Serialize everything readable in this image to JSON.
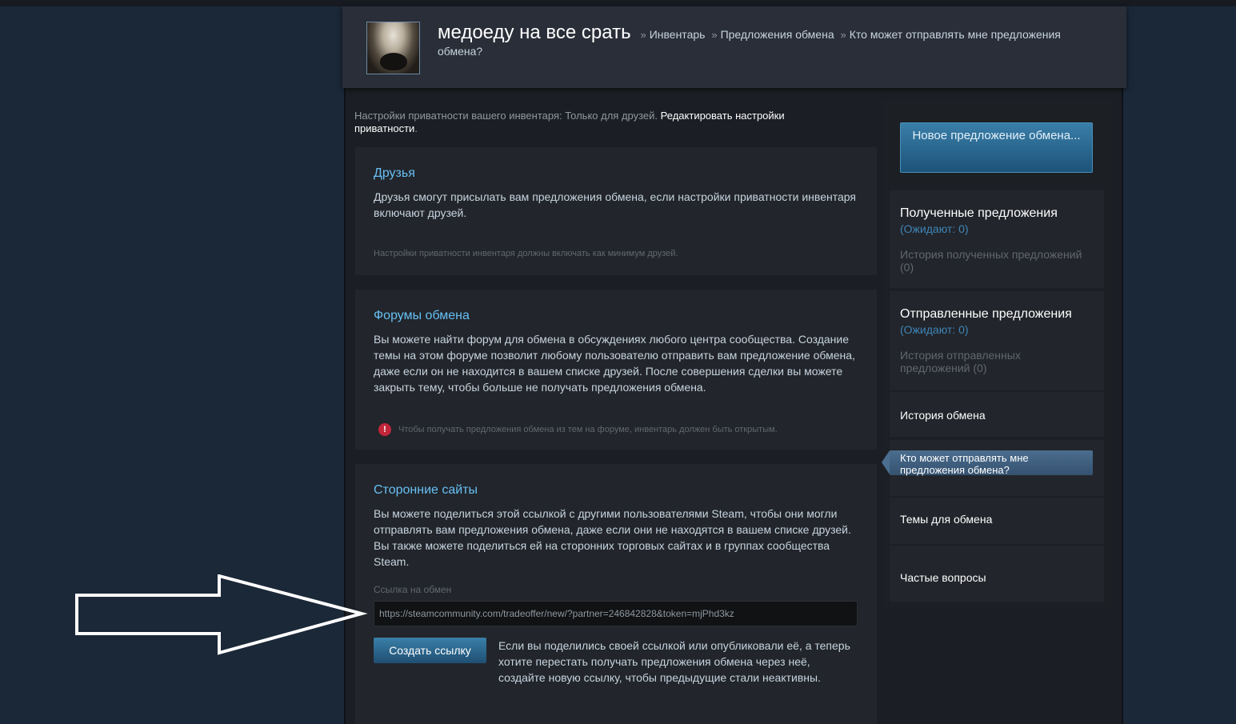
{
  "header": {
    "profile_name": "медоеду на все срать",
    "breadcrumb_sep": "»",
    "crumb_inventory": "Инвентарь",
    "crumb_trade_offers": "Предложения обмена",
    "crumb_current": "Кто может отправлять мне предложения обмена?"
  },
  "privacy": {
    "text": "Настройки приватности вашего инвентаря: Только для друзей.",
    "edit_link": "Редактировать настройки приватности",
    "end": "."
  },
  "friends": {
    "title": "Друзья",
    "body": "Друзья смогут присылать вам предложения обмена, если настройки приватности инвентаря включают друзей.",
    "note": "Настройки приватности инвентаря должны включать как минимум друзей."
  },
  "forums": {
    "title": "Форумы обмена",
    "body": "Вы можете найти форум для обмена в обсуждениях любого центра сообщества. Создание темы на этом форуме позволит любому пользователю отправить вам предложение обмена, даже если он не находится в вашем списке друзей. После совершения сделки вы можете закрыть тему, чтобы больше не получать предложения обмена.",
    "warning_icon_glyph": "!",
    "note": "Чтобы получать предложения обмена из тем на форуме, инвентарь должен быть открытым."
  },
  "third_party": {
    "title": "Сторонние сайты",
    "body": "Вы можете поделиться этой ссылкой с другими пользователями Steam, чтобы они могли отправлять вам предложения обмена, даже если они не находятся в вашем списке друзей. Вы также можете поделиться ей на сторонних торговых сайтах и в группах сообщества Steam.",
    "field_label": "Ссылка на обмен",
    "trade_url": "https://steamcommunity.com/tradeoffer/new/?partner=246842828&token=mjPhd3kz",
    "create_button": "Создать ссылку",
    "create_desc": "Если вы поделились своей ссылкой или опубликовали её, а теперь хотите перестать получать предложения обмена через неё, создайте новую ссылку, чтобы предыдущие стали неактивны."
  },
  "sidebar": {
    "new_offer_button": "Новое предложение обмена...",
    "received_title": "Полученные предложения",
    "received_pending": "(Ожидают: 0)",
    "received_history": "История полученных предложений (0)",
    "sent_title": "Отправленные предложения",
    "sent_pending": "(Ожидают: 0)",
    "sent_history": "История отправленных предложений (0)",
    "trade_history": "История обмена",
    "who_can_send": "Кто может отправлять мне предложения обмена?",
    "trade_topics": "Темы для обмена",
    "faq": "Частые вопросы"
  },
  "colors": {
    "background": "#1b2838",
    "accent_link": "#66c0f4",
    "button_blue": "#1f4f72",
    "warning_red": "#c2263a"
  }
}
